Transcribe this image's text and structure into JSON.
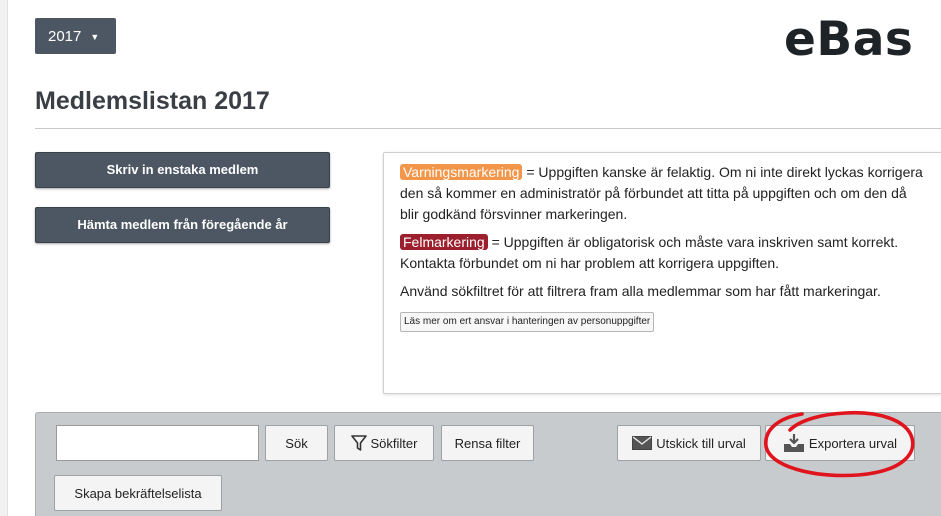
{
  "header": {
    "year_select": {
      "value": "2017",
      "caret": "▼"
    },
    "logo": "eBas"
  },
  "page": {
    "title": "Medlemslistan 2017"
  },
  "actions": {
    "add_member": "Skriv in enstaka medlem",
    "fetch_previous": "Hämta medlem från föregående år"
  },
  "info": {
    "warning_tag": "Varningsmarkering",
    "warning_text": "= Uppgiften kanske är felaktig. Om ni inte direkt lyckas korrigera den så kommer en administratör på förbundet att titta på uppgiften och om den då blir godkänd försvinner markeringen.",
    "error_tag": "Felmarkering",
    "error_text": "= Uppgiften är obligatorisk och måste vara inskriven samt korrekt. Kontakta förbundet om ni har problem att korrigera uppgiften.",
    "filter_text": "Använd sökfiltret för att filtrera fram alla medlemmar som har fått markeringar.",
    "more_button": "Läs mer om ert ansvar i hanteringen av personuppgifter"
  },
  "toolbar": {
    "search_value": "",
    "search_button": "Sök",
    "filter_button": "Sökfilter",
    "clear_button": "Rensa filter",
    "mail_button": "Utskick till urval",
    "export_button": "Exportera urval",
    "confirm_button": "Skapa bekräftelselista"
  },
  "colors": {
    "dark_button": "#4d5763",
    "warning_tag": "#f3964a",
    "error_tag": "#9b1f2c",
    "annotation": "#e0141c"
  },
  "icons": {
    "filter": "funnel-icon",
    "mail": "envelope-icon",
    "export": "tray-download-icon"
  }
}
